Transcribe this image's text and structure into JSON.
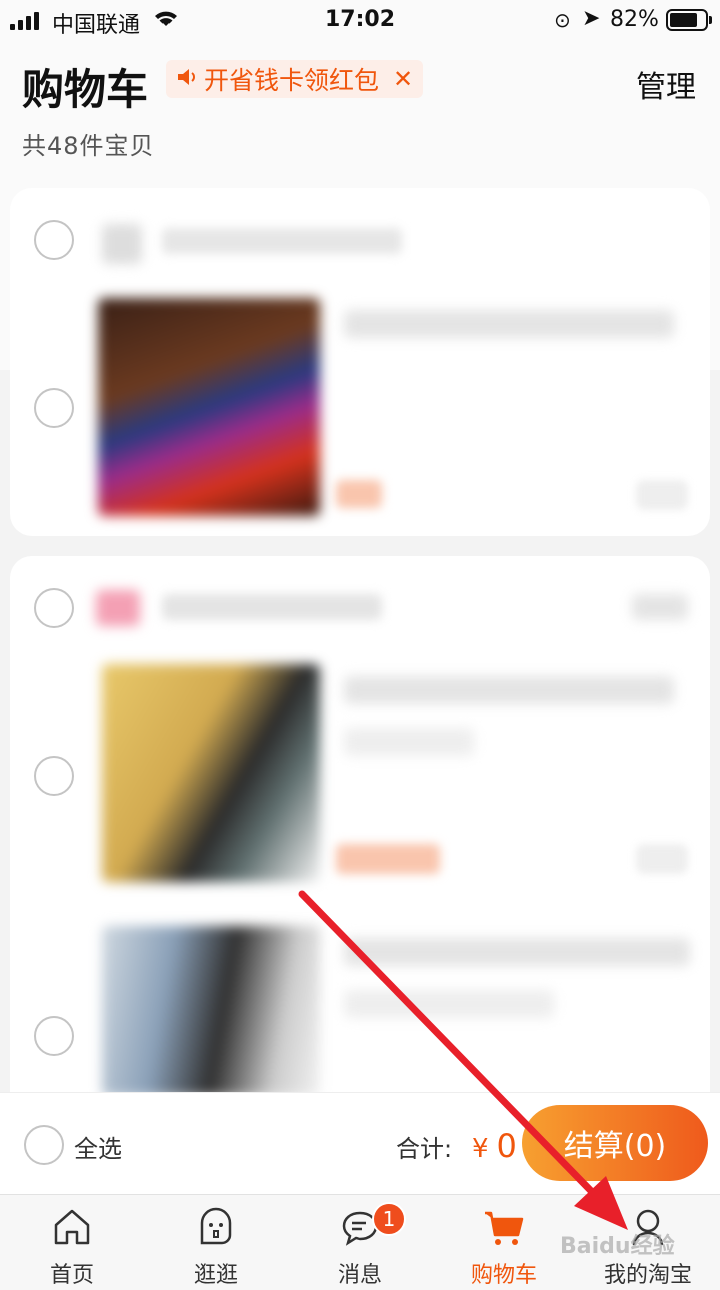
{
  "status_bar": {
    "carrier": "中国联通",
    "time": "17:02",
    "battery": "82%"
  },
  "header": {
    "title": "购物车",
    "promo_text": "开省钱卡领红包",
    "manage_label": "管理",
    "item_count": "共48件宝贝"
  },
  "bottom_bar": {
    "select_all_label": "全选",
    "total_label": "合计:",
    "currency": "¥",
    "total_value": "0",
    "checkout_label": "结算(0)"
  },
  "tabs": [
    {
      "label": "首页",
      "icon": "home-icon"
    },
    {
      "label": "逛逛",
      "icon": "browse-face-icon"
    },
    {
      "label": "消息",
      "icon": "message-icon",
      "badge": "1"
    },
    {
      "label": "购物车",
      "icon": "cart-icon",
      "active": true
    },
    {
      "label": "我的淘宝",
      "icon": "profile-icon"
    }
  ],
  "watermark": "Baidu经验",
  "colors": {
    "accent": "#f0560d",
    "checkout_start": "#f7a030",
    "checkout_end": "#ef5a1c",
    "arrow": "#e8202a"
  }
}
